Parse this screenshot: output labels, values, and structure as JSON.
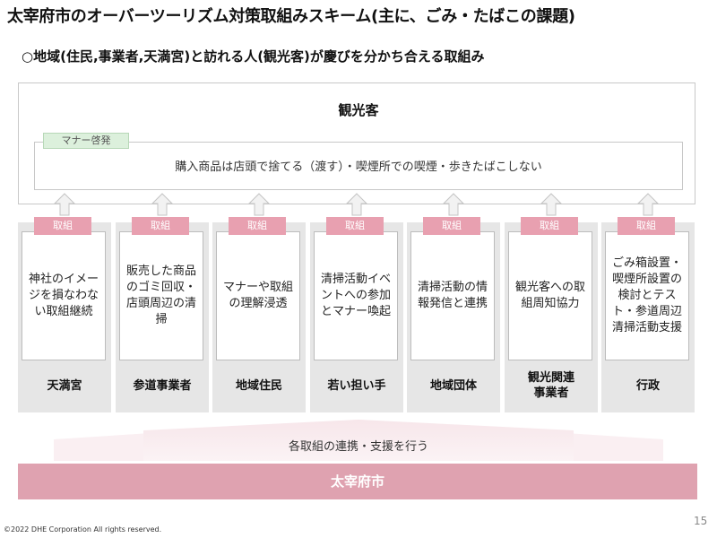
{
  "title": "太宰府市のオーバーツーリズム対策取組みスキーム(主に、ごみ・たばこの課題)",
  "subtitle": "○地域(住民,事業者,天満宮)と訪れる人(観光客)が慶びを分かち合える取組み",
  "visitor_panel": {
    "title": "観光客",
    "tag": "マナー啓発",
    "text": "購入商品は店頭で捨てる（渡す）・喫煙所での喫煙・歩きたばこしない"
  },
  "columns": [
    {
      "tag": "取組",
      "desc": "神社のイメージを損なわない取組継続",
      "name": "天満宮"
    },
    {
      "tag": "取組",
      "desc": "販売した商品のゴミ回収・店頭周辺の清掃",
      "name": "参道事業者"
    },
    {
      "tag": "取組",
      "desc": "マナーや取組の理解浸透",
      "name": "地域住民"
    },
    {
      "tag": "取組",
      "desc": "清掃活動イベントへの参加とマナー喚起",
      "name": "若い担い手"
    },
    {
      "tag": "取組",
      "desc": "清掃活動の情報発信と連携",
      "name": "地域団体"
    },
    {
      "tag": "取組",
      "desc": "観光客への取組周知協力",
      "name": "観光関連\n事業者"
    },
    {
      "tag": "取組",
      "desc": "ごみ箱設置・喫煙所設置の検討とテスト・参道周辺清掃活動支援",
      "name": "行政"
    }
  ],
  "collaboration_text": "各取組の連携・支援を行う",
  "city_bar": "太宰府市",
  "footer": "©2022 DHE Corporation All rights reserved.",
  "page_number": "15",
  "colors": {
    "accent_pink": "#dfa2b0",
    "tag_pink": "#e8a0b0",
    "manner_tag_green": "#dcf0dc",
    "column_gray": "#e6e6e6"
  }
}
